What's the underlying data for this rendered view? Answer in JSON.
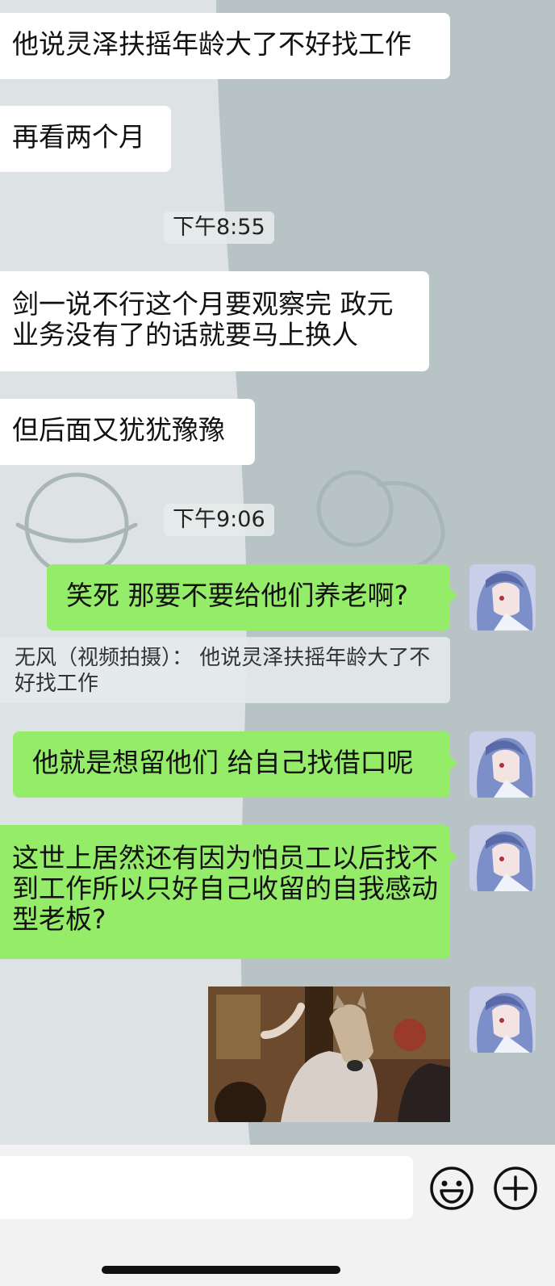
{
  "messages": {
    "m1": "他说灵泽扶摇年龄大了不好找工作",
    "m2": "再看两个月",
    "t1": "下午8:55",
    "m3": "剑一说不行这个月要观察完 政元业务没有了的话就要马上换人",
    "m4": "但后面又犹犹豫豫",
    "t2": "下午9:06",
    "m5": "笑死 那要不要给他们养老啊?",
    "quote": "无风（视频拍摄）：  他说灵泽扶摇年龄大了不好找工作",
    "m6": "他就是想留他们 给自己找借口呢",
    "m7": "这世上居然还有因为怕员工以后找不到工作所以只好自己收留的自我感动型老板?"
  },
  "icons": {
    "avatar": "anime-avatar",
    "emoji": "smiley-icon",
    "plus": "plus-circle-icon"
  },
  "colors": {
    "outgoing_bubble": "#95ec69",
    "incoming_bubble": "#ffffff",
    "chat_bg": "#b8c4c4"
  }
}
